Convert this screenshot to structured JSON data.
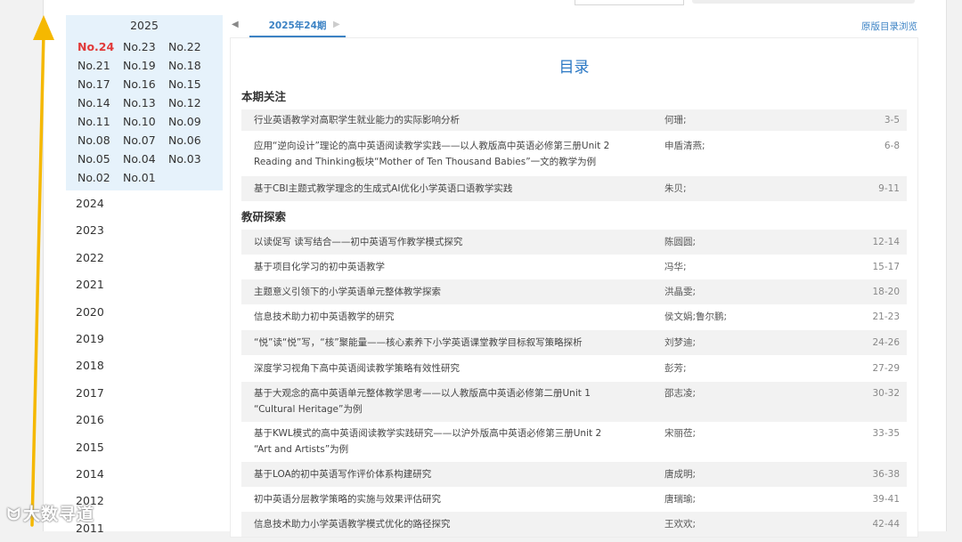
{
  "sidebar": {
    "active_year": "2025",
    "issues": [
      "No.24",
      "No.23",
      "No.22",
      "No.21",
      "No.19",
      "No.18",
      "No.17",
      "No.16",
      "No.15",
      "No.14",
      "No.13",
      "No.12",
      "No.11",
      "No.10",
      "No.09",
      "No.08",
      "No.07",
      "No.06",
      "No.05",
      "No.04",
      "No.03",
      "No.02",
      "No.01"
    ],
    "years": [
      "2024",
      "2023",
      "2022",
      "2021",
      "2020",
      "2019",
      "2018",
      "2017",
      "2016",
      "2015",
      "2014",
      "2012",
      "2011"
    ]
  },
  "tabs": {
    "current": "2025年24期",
    "original_link": "原版目录浏览",
    "prev_icon": "triangle-left-icon",
    "next_icon": "triangle-right-icon"
  },
  "toc": {
    "title": "目录",
    "sections": [
      {
        "name": "本期关注",
        "articles": [
          {
            "title": "行业英语教学对高职学生就业能力的实际影响分析",
            "authors": "何珊;",
            "pages": "3-5"
          },
          {
            "title": "应用“逆向设计”理论的高中英语阅读教学实践——以人教版高中英语必修第三册Unit 2 Reading and Thinking板块“Mother of Ten Thousand Babies”一文的教学为例",
            "authors": "申盾清燕;",
            "pages": "6-8"
          },
          {
            "title": "基于CBI主题式教学理念的生成式AI优化小学英语口语教学实践",
            "authors": "朱贝;",
            "pages": "9-11"
          }
        ]
      },
      {
        "name": "教研探索",
        "articles": [
          {
            "title": "以读促写 读写结合——初中英语写作教学模式探究",
            "authors": "陈圆圆;",
            "pages": "12-14"
          },
          {
            "title": "基于项目化学习的初中英语教学",
            "authors": "冯华;",
            "pages": "15-17"
          },
          {
            "title": "主题意义引领下的小学英语单元整体教学探索",
            "authors": "洪晶雯;",
            "pages": "18-20"
          },
          {
            "title": "信息技术助力初中英语教学的研究",
            "authors": "侯文娟;鲁尔鹏;",
            "pages": "21-23"
          },
          {
            "title": "“悦”读“悦”写，“核”聚能量——核心素养下小学英语课堂教学目标叙写策略探析",
            "authors": "刘梦迪;",
            "pages": "24-26"
          },
          {
            "title": "深度学习视角下高中英语阅读教学策略有效性研究",
            "authors": "彭芳;",
            "pages": "27-29"
          },
          {
            "title": "基于大观念的高中英语单元整体教学思考——以人教版高中英语必修第二册Unit 1 “Cultural Heritage”为例",
            "authors": "邵志凌;",
            "pages": "30-32"
          },
          {
            "title": "基于KWL模式的高中英语阅读教学实践研究——以沪外版高中英语必修第三册Unit 2 “Art and Artists”为例",
            "authors": "宋丽莅;",
            "pages": "33-35"
          },
          {
            "title": "基于LOA的初中英语写作评价体系构建研究",
            "authors": "唐成明;",
            "pages": "36-38"
          },
          {
            "title": "初中英语分层教学策略的实施与效果评估研究",
            "authors": "唐瑞瑜;",
            "pages": "39-41"
          },
          {
            "title": "信息技术助力小学英语教学模式优化的路径探究",
            "authors": "王欢欢;",
            "pages": "42-44"
          }
        ]
      }
    ]
  },
  "watermark": {
    "text": "大数寻道",
    "icon": "paw-icon"
  },
  "colors": {
    "accent": "#2b78c4",
    "active_issue": "#e13a3a",
    "annotation_arrow": "#f5b800"
  }
}
